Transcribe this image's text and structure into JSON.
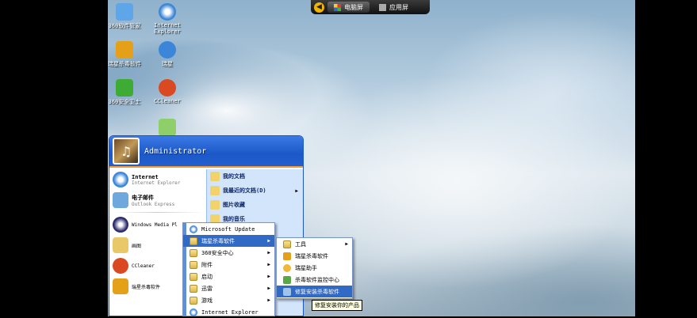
{
  "switcher": {
    "tabs": [
      {
        "label": "电脑屏",
        "active": true
      },
      {
        "label": "应用屏",
        "active": false
      }
    ]
  },
  "desktop_icons": [
    {
      "label": "360软件管家",
      "icon": "software-manager-icon",
      "color": "#5ea6e8"
    },
    {
      "label": "Internet Explorer",
      "icon": "internet-explorer-icon",
      "color": "#3b86d8"
    },
    {
      "label": "瑞星杀毒软件",
      "icon": "rising-antivirus-icon",
      "color": "#e5a019"
    },
    {
      "label": "瑞星",
      "icon": "rising-icon",
      "color": "#3b86d8"
    },
    {
      "label": "360安全卫士",
      "icon": "360-security-icon",
      "color": "#3eab35"
    },
    {
      "label": "CCleaner",
      "icon": "ccleaner-icon",
      "color": "#d94a23"
    },
    {
      "label": "",
      "icon": "recycle-bin-icon",
      "color": "#8fcf6a"
    }
  ],
  "start_menu": {
    "user": "Administrator",
    "pinned": [
      {
        "title": "Internet",
        "subtitle": "Internet Explorer",
        "icon": "internet-explorer-icon"
      },
      {
        "title": "电子邮件",
        "subtitle": "Outlook Express",
        "icon": "outlook-express-icon"
      }
    ],
    "recent": [
      {
        "title": "Windows Media Pl",
        "icon": "media-player-icon"
      },
      {
        "title": "画图",
        "icon": "paint-icon"
      },
      {
        "title": "CCleaner",
        "icon": "ccleaner-icon"
      },
      {
        "title": "瑞星杀毒软件",
        "icon": "rising-antivirus-icon"
      }
    ],
    "right_items": [
      {
        "label": "我的文档",
        "icon": "documents-folder-icon",
        "arrow": false
      },
      {
        "label": "我最近的文档(D)",
        "icon": "recent-documents-icon",
        "arrow": true
      },
      {
        "label": "图片收藏",
        "icon": "pictures-folder-icon",
        "arrow": false
      },
      {
        "label": "我的音乐",
        "icon": "music-folder-icon",
        "arrow": false
      }
    ]
  },
  "programs_menu": [
    {
      "label": "Microsoft Update",
      "icon": "update-icon",
      "arrow": false,
      "highlight": false
    },
    {
      "label": "瑞星杀毒软件",
      "icon": "folder-icon",
      "arrow": true,
      "highlight": true
    },
    {
      "label": "360安全中心",
      "icon": "folder-icon",
      "arrow": true,
      "highlight": false
    },
    {
      "label": "附件",
      "icon": "folder-icon",
      "arrow": true,
      "highlight": false
    },
    {
      "label": "启动",
      "icon": "folder-icon",
      "arrow": true,
      "highlight": false
    },
    {
      "label": "迅雷",
      "icon": "folder-icon",
      "arrow": true,
      "highlight": false
    },
    {
      "label": "游戏",
      "icon": "folder-icon",
      "arrow": true,
      "highlight": false
    },
    {
      "label": "Internet Explorer",
      "icon": "internet-explorer-icon",
      "arrow": false,
      "highlight": false
    }
  ],
  "rising_submenu": [
    {
      "label": "工具",
      "icon": "folder-icon",
      "arrow": true,
      "highlight": false
    },
    {
      "label": "瑞星杀毒软件",
      "icon": "rising-antivirus-icon",
      "arrow": false,
      "highlight": false
    },
    {
      "label": "瑞星助手",
      "icon": "rising-helper-icon",
      "arrow": false,
      "highlight": false
    },
    {
      "label": "杀毒软件监控中心",
      "icon": "monitor-center-icon",
      "arrow": false,
      "highlight": false
    },
    {
      "label": "修复安装杀毒软件",
      "icon": "repair-install-icon",
      "arrow": false,
      "highlight": true
    }
  ],
  "tooltip": "修复安装你的产品"
}
